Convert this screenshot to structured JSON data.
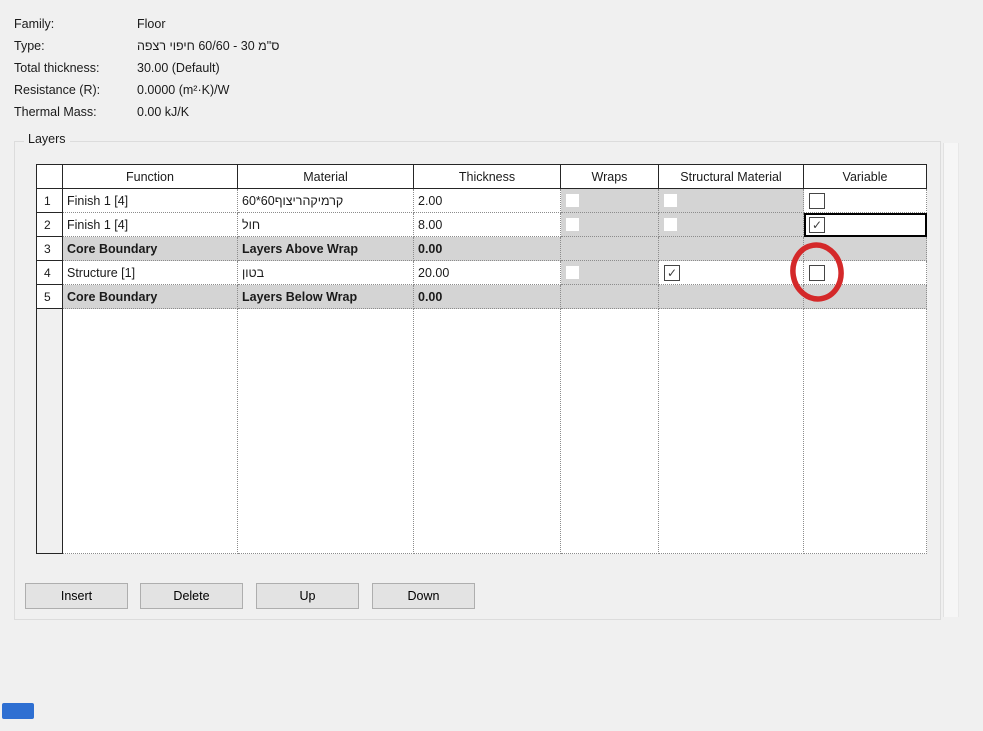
{
  "info": {
    "family_label": "Family:",
    "family_value": "Floor",
    "type_label": "Type:",
    "type_value": "רצפה חיפוי 60/60 - 30 ס\"מ",
    "thickness_label": "Total thickness:",
    "thickness_value": "30.00 (Default)",
    "resistance_label": "Resistance (R):",
    "resistance_value": "0.0000 (m²·K)/W",
    "thermal_label": "Thermal Mass:",
    "thermal_value": "0.00 kJ/K"
  },
  "layers": {
    "group_title": "Layers",
    "columns": {
      "number": "",
      "function": "Function",
      "material": "Material",
      "thickness": "Thickness",
      "wraps": "Wraps",
      "structural": "Structural Material",
      "variable": "Variable"
    },
    "rows": [
      {
        "num": "1",
        "function": "Finish 1 [4]",
        "material": "60*60 ריצוף קרמיקה",
        "thickness": "2.00",
        "wraps": "flat",
        "structural": "flat",
        "variable": "unchecked"
      },
      {
        "num": "2",
        "function": "Finish 1 [4]",
        "material": "חול",
        "thickness": "8.00",
        "wraps": "flat",
        "structural": "flat",
        "variable": "checked-focused"
      },
      {
        "num": "3",
        "function": "Core Boundary",
        "material": "Layers Above Wrap",
        "thickness": "0.00",
        "wraps": "none",
        "structural": "none",
        "variable": "none"
      },
      {
        "num": "4",
        "function": "Structure [1]",
        "material": "בטון",
        "thickness": "20.00",
        "wraps": "flat",
        "structural": "checked",
        "variable": "unchecked"
      },
      {
        "num": "5",
        "function": "Core Boundary",
        "material": "Layers Below Wrap",
        "thickness": "0.00",
        "wraps": "none",
        "structural": "none",
        "variable": "none"
      }
    ],
    "buttons": {
      "insert": "Insert",
      "delete": "Delete",
      "up": "Up",
      "down": "Down"
    }
  },
  "annotations": {
    "red_circle_color": "#d4292a",
    "blue_rect_color": "#2e6fd2",
    "circled_cell": "row 4 Variable checkbox"
  }
}
